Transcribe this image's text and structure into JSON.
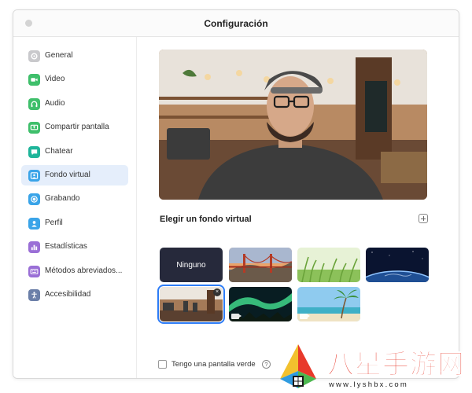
{
  "window": {
    "title": "Configuración"
  },
  "sidebar": {
    "items": [
      {
        "label": "General",
        "icon": "gear-icon",
        "color": "#c9c9cc"
      },
      {
        "label": "Video",
        "icon": "video-icon",
        "color": "#3fbf6b"
      },
      {
        "label": "Audio",
        "icon": "headphones-icon",
        "color": "#3fbf6b"
      },
      {
        "label": "Compartir pantalla",
        "icon": "share-screen-icon",
        "color": "#3fbf6b"
      },
      {
        "label": "Chatear",
        "icon": "chat-icon",
        "color": "#1fb59a"
      },
      {
        "label": "Fondo virtual",
        "icon": "virtual-background-icon",
        "color": "#3aa4e8",
        "active": true
      },
      {
        "label": "Grabando",
        "icon": "record-icon",
        "color": "#3aa4e8"
      },
      {
        "label": "Perfil",
        "icon": "profile-icon",
        "color": "#3aa4e8"
      },
      {
        "label": "Estadísticas",
        "icon": "statistics-icon",
        "color": "#9a6fd6"
      },
      {
        "label": "Métodos abreviados...",
        "icon": "keyboard-icon",
        "color": "#9a6fd6"
      },
      {
        "label": "Accesibilidad",
        "icon": "accessibility-icon",
        "color": "#6b7fa8"
      }
    ]
  },
  "virtual_background": {
    "title": "Elegir un fondo virtual",
    "none_label": "Ninguno",
    "green_screen_label": "Tengo una pantalla verde",
    "help_glyph": "?"
  },
  "watermark": {
    "text": "八星手游网",
    "url": "www.lyshbx.com"
  },
  "colors": {
    "accent": "#2d7cf6",
    "active_row": "#e5eefb"
  }
}
